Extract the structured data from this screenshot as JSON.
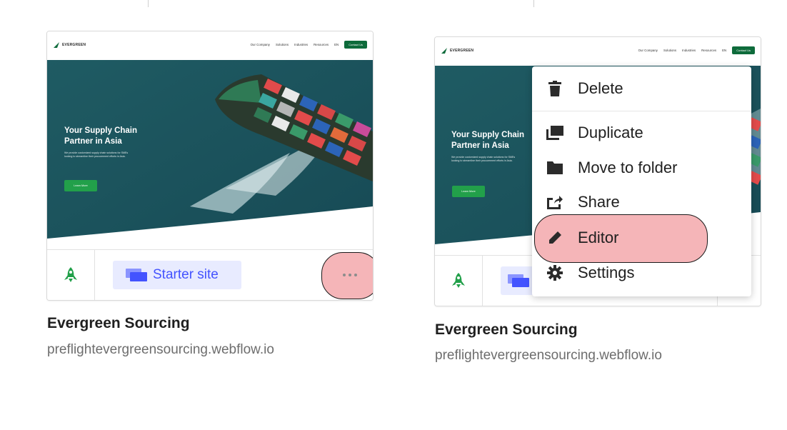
{
  "site": {
    "name": "Evergreen Sourcing",
    "url": "preflightevergreensourcing.webflow.io",
    "plan_label": "Starter site"
  },
  "preview": {
    "logo_text": "EVERGREEN",
    "nav_links": [
      "Our Company",
      "Solutions",
      "Industries",
      "Resources",
      "EN"
    ],
    "nav_cta": "Contact Us",
    "hero_title_line1": "Your Supply Chain",
    "hero_title_line2": "Partner in Asia",
    "hero_subtitle_line1": "We provide customized supply chain solutions for SMEs",
    "hero_subtitle_line2": "looking to streamline their procurement efforts in Asia.",
    "hero_button": "Learn More"
  },
  "context_menu": {
    "items": [
      {
        "label": "Delete",
        "icon": "trash-icon"
      },
      {
        "label": "Duplicate",
        "icon": "duplicate-icon"
      },
      {
        "label": "Move to folder",
        "icon": "folder-icon"
      },
      {
        "label": "Share",
        "icon": "share-icon"
      },
      {
        "label": "Editor",
        "icon": "pencil-icon"
      },
      {
        "label": "Settings",
        "icon": "gear-icon"
      }
    ]
  },
  "colors": {
    "brand_green": "#0e6b3b",
    "rocket_green": "#22a04a",
    "plan_blue": "#4353ff",
    "plan_bg": "#e8ebff",
    "highlight": "#f5b5b8"
  }
}
